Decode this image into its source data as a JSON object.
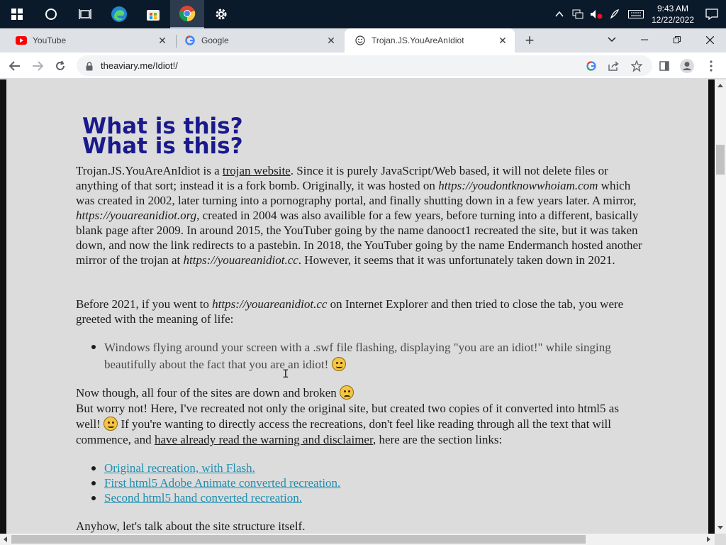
{
  "taskbar": {
    "time": "9:43 AM",
    "date": "12/22/2022"
  },
  "browser": {
    "tabs": [
      {
        "title": "YouTube",
        "icon": "youtube-icon"
      },
      {
        "title": "Google",
        "icon": "google-icon"
      },
      {
        "title": "Trojan.JS.YouAreAnIdiot",
        "icon": "smiley-icon",
        "active": true
      }
    ],
    "url": "theaviary.me/Idiot!/"
  },
  "page": {
    "heading": "What is this?",
    "intro": {
      "p1_a": "Trojan.JS.YouAreAnIdiot is a ",
      "p1_link": "trojan website",
      "p1_b": ". Since it is purely JavaScript/Web based, it will not delete files or anything of that sort; instead it is a fork bomb. Originally, it was hosted on ",
      "p1_url1": "https://youdontknowwhoiam.com",
      "p1_c": " which was created in 2002, later turning into a pornography portal, and finally shutting down in a few years later. A mirror, ",
      "p1_url2": "https://youareanidiot.org",
      "p1_d": ", created in 2004 was also availible for a few years, before turning into a different, basically blank page after 2009. In around 2015, the YouTuber going by the name danooct1 recreated the site, but it was taken down, and now the link redirects to a pastebin. In 2018, the YouTuber going by the name Endermanch hosted another mirror of the trojan at ",
      "p1_url3": "https://youareanidiot.cc",
      "p1_e": ". However, it seems that it was unfortunately taken down in 2021."
    },
    "before": {
      "a": "Before 2021, if you went to ",
      "url": "https://youareanidiot.cc",
      "b": " on Internet Explorer and then tried to close the tab, you were greeted with the meaning of life:"
    },
    "bullet1": "Windows flying around your screen with a .swf file flashing, displaying \"you are an idiot!\" while singing beautifully about the fact that you are an idiot!",
    "now": "Now though, all four of the sites are down and broken",
    "worry_a": "But worry not! Here, I've recreated not only the original site, but created two copies of it converted into html5 as well!",
    "worry_b": " If you're wanting to directly access the recreations, don't feel like reading through all the text that will commence, and ",
    "worry_link": "have already read the warning and disclaimer",
    "worry_c": ", here are the section links:",
    "links": [
      "Original recreation, with Flash.",
      "First html5 Adobe Animate converted recreation.",
      "Second html5 hand converted recreation."
    ],
    "anyhow": "Anyhow, let's talk about the site structure itself."
  }
}
